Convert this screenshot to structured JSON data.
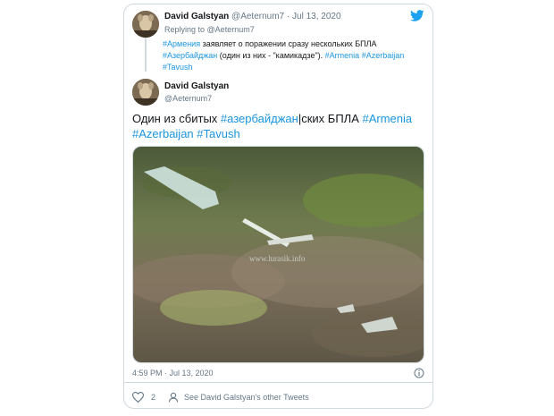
{
  "reply_tweet": {
    "author_name": "David Galstyan",
    "handle": "@Aeternum7",
    "date": "Jul 13, 2020",
    "separator": " · ",
    "replying_prefix": "Replying to",
    "replying_to": "@Aeternum7",
    "text_tag1": "#Армения",
    "text_part1": " заявляет о поражении сразу нескольких БПЛА ",
    "text_tag2": "#Азербайджан",
    "text_part2": " (один из них - \"камикадзе\"). ",
    "text_tag3": "#Armenia",
    "text_tag4": "#Azerbaijan",
    "text_tag5": "#Tavush"
  },
  "main_tweet": {
    "author_name": "David Galstyan",
    "handle": "@Aeternum7",
    "text_part1": "Один из сбитых ",
    "text_tag1": "#азербайджан",
    "text_part2": "|ских БПЛА ",
    "text_tag2": "#Armenia",
    "text_tag3": "#Azerbaijan",
    "text_tag4": "#Tavush",
    "image_watermark": "www.lurasik.info",
    "timestamp": "4:59 PM · Jul 13, 2020",
    "likes": "2",
    "other_tweets_link": "See David Galstyan's other Tweets"
  },
  "icons": {
    "brand": "twitter-bird-icon",
    "info": "info-icon",
    "like": "heart-icon",
    "profile": "person-icon"
  },
  "colors": {
    "link": "#1b95e0",
    "twitter_blue": "#1da1f2",
    "muted": "#657786",
    "border": "#cfd9de"
  }
}
